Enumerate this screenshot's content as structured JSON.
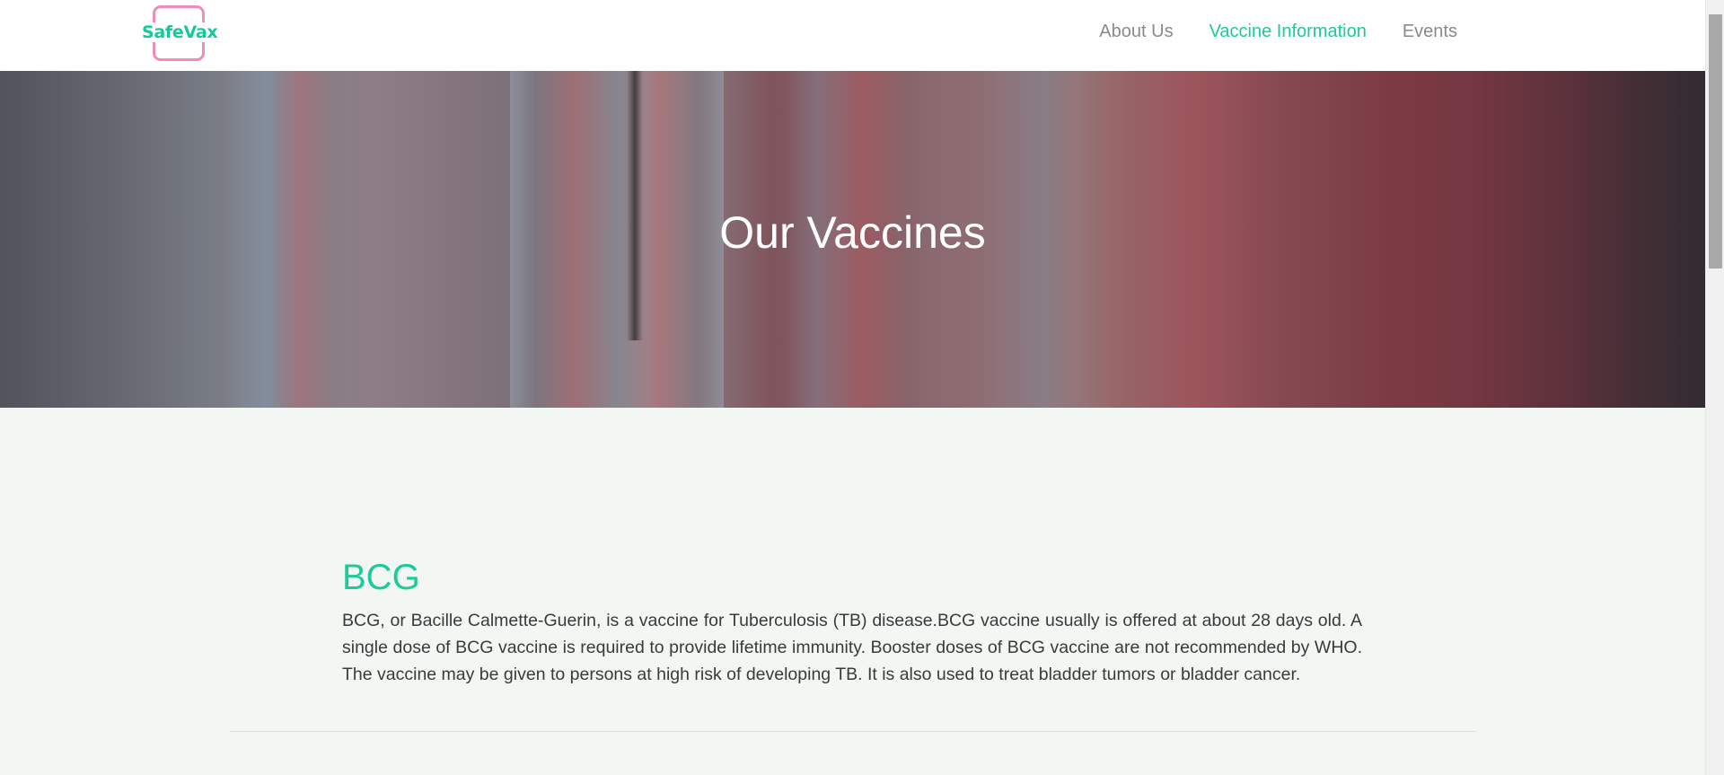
{
  "brand": {
    "logo_text": "SafeVax",
    "logo_color": "#16c99a",
    "frame_color": "#f08cb8"
  },
  "nav": {
    "items": [
      {
        "label": "About Us",
        "active": false
      },
      {
        "label": "Vaccine Information",
        "active": true
      },
      {
        "label": "Events",
        "active": false
      }
    ],
    "active_color": "#1ccb97",
    "inactive_color": "#8a8a8a"
  },
  "hero": {
    "title": "Our Vaccines"
  },
  "vaccines": [
    {
      "name": "BCG",
      "description": "BCG, or Bacille Calmette-Guerin, is a vaccine for Tuberculosis (TB) disease.BCG vaccine usually is offered at about 28 days old. A single dose of BCG vaccine is required to provide lifetime immunity. Booster doses of BCG vaccine are not recommended by WHO. The vaccine may be given to persons at high risk of developing TB. It is also used to treat bladder tumors or bladder cancer."
    }
  ]
}
